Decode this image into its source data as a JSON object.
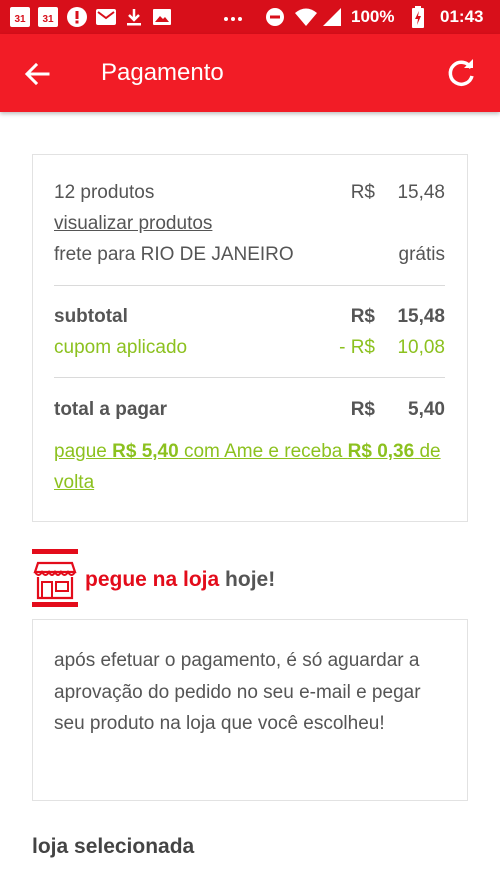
{
  "status_bar": {
    "calendar_1": "31",
    "calendar_2": "31",
    "battery": "100%",
    "time": "01:43",
    "icons": [
      "calendar-icon",
      "calendar-icon",
      "alert-icon",
      "mail-icon",
      "download-icon",
      "image-icon",
      "more-dots-icon",
      "do-not-disturb-icon",
      "wifi-icon",
      "signal-icon",
      "battery-charging-icon"
    ]
  },
  "app_bar": {
    "title": "Pagamento",
    "back_icon": "arrow-back-icon",
    "refresh_icon": "refresh-icon"
  },
  "summary": {
    "products_label": "12 produtos",
    "products_currency": "R$",
    "products_value": "15,48",
    "view_products_link": "visualizar produtos",
    "shipping_label": "frete para RIO DE JANEIRO",
    "shipping_value": "grátis",
    "subtotal_label": "subtotal",
    "subtotal_currency": "R$",
    "subtotal_value": "15,48",
    "coupon_label": "cupom aplicado",
    "coupon_currency": "- R$",
    "coupon_value": "10,08",
    "total_label": "total a pagar",
    "total_currency": "R$",
    "total_value": "5,40",
    "ame_prefix": "pague ",
    "ame_amount": "R$ 5,40",
    "ame_middle": " com Ame e receba ",
    "ame_cashback": "R$ 0,36",
    "ame_suffix": " de volta"
  },
  "store": {
    "icon": "store-icon",
    "title_highlight": "pegue na loja",
    "title_rest": " hoje!",
    "info_text": "após efetuar o pagamento, é só aguardar a aprovação do pedido no seu e-mail e pegar seu produto na loja que você escolheu!"
  },
  "selected_store_title": "loja selecionada",
  "colors": {
    "status_bar": "#d80f1a",
    "app_bar": "#f21c26",
    "accent_green": "#8cc11f",
    "brand_red": "#e30c1b"
  }
}
